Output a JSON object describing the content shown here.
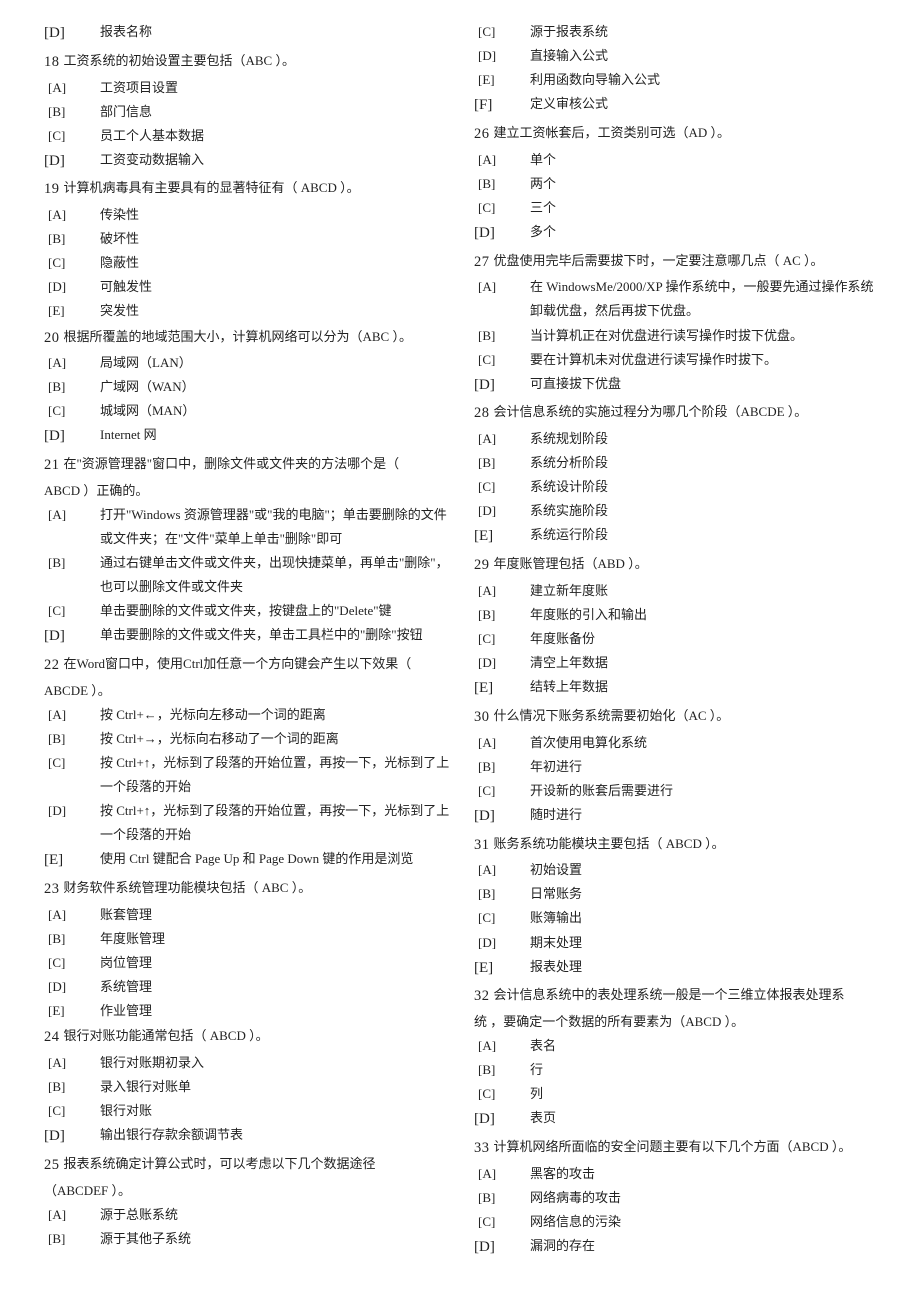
{
  "pre_option": {
    "letter": "[D]",
    "text": "报表名称",
    "big": true
  },
  "q18": {
    "num": "18",
    "text": "工资系统的初始设置主要包括（ABC  ）。",
    "opts": [
      {
        "l": "[A]",
        "t": "工资项目设置",
        "big": false
      },
      {
        "l": "[B]",
        "t": "部门信息",
        "big": false
      },
      {
        "l": "[C]",
        "t": "员工个人基本数据",
        "big": false
      },
      {
        "l": "[D]",
        "t": "工资变动数据输入",
        "big": true
      }
    ]
  },
  "q19": {
    "num": "19",
    "text": "计算机病毒具有主要具有的显著特征有（ ABCD ）。",
    "opts": [
      {
        "l": "[A]",
        "t": "传染性",
        "big": false
      },
      {
        "l": "[B]",
        "t": "破坏性",
        "big": false
      },
      {
        "l": "[C]",
        "t": "隐蔽性",
        "big": false
      },
      {
        "l": "[D]",
        "t": "可触发性",
        "big": false
      },
      {
        "l": "[E]",
        "t": "突发性",
        "big": false
      }
    ]
  },
  "q20": {
    "num": "20",
    "text": "根据所覆盖的地域范围大小，计算机网络可以分为（ABC  ）。",
    "opts": [
      {
        "l": "[A]",
        "t": "局域网（LAN）",
        "big": false
      },
      {
        "l": "[B]",
        "t": "广域网（WAN）",
        "big": false
      },
      {
        "l": "[C]",
        "t": "城域网（MAN）",
        "big": false
      },
      {
        "l": "[D]",
        "t": "Internet 网",
        "big": true
      }
    ]
  },
  "q21": {
    "num": "21",
    "line1": "在\"资源管理器\"窗口中，删除文件或文件夹的方法哪个是（",
    "line2": "ABCD ）正确的。",
    "opts": [
      {
        "l": "[A]",
        "t": "打开\"Windows 资源管理器\"或\"我的电脑\"；单击要删除的文件或文件夹；在\"文件\"菜单上单击\"删除\"即可",
        "big": false
      },
      {
        "l": "[B]",
        "t": "通过右键单击文件或文件夹，出现快捷菜单，再单击\"删除\"，也可以删除文件或文件夹",
        "big": false
      },
      {
        "l": "[C]",
        "t": "单击要删除的文件或文件夹，按键盘上的\"Delete\"键",
        "big": false
      },
      {
        "l": "[D]",
        "t": "单击要删除的文件或文件夹，单击工具栏中的\"删除\"按钮",
        "big": true
      }
    ]
  },
  "q22": {
    "num": "22",
    "line1": "在Word窗口中，使用Ctrl加任意一个方向键会产生以下效果（",
    "line2": "ABCDE ）。",
    "opts": [
      {
        "l": "[A]",
        "t": "按 Ctrl+←，光标向左移动一个词的距离",
        "big": false
      },
      {
        "l": "[B]",
        "t": "按 Ctrl+→，光标向右移动了一个词的距离",
        "big": false
      },
      {
        "l": "[C]",
        "t": "按 Ctrl+↑，光标到了段落的开始位置，再按一下，光标到了上一个段落的开始",
        "big": false
      },
      {
        "l": "[D]",
        "t": "按 Ctrl+↑，光标到了段落的开始位置，再按一下，光标到了上一个段落的开始",
        "big": false
      },
      {
        "l": "[E]",
        "t": "使用 Ctrl 键配合 Page Up 和 Page Down 键的作用是浏览",
        "big": true
      }
    ]
  },
  "q23": {
    "num": "23",
    "text": "财务软件系统管理功能模块包括（ ABC ）。",
    "opts": [
      {
        "l": "[A]",
        "t": "账套管理",
        "big": false
      },
      {
        "l": "[B]",
        "t": "年度账管理",
        "big": false
      },
      {
        "l": "[C]",
        "t": "岗位管理",
        "big": false
      },
      {
        "l": "[D]",
        "t": "系统管理",
        "big": false
      },
      {
        "l": "[E]",
        "t": "作业管理",
        "big": false
      }
    ]
  },
  "q24": {
    "num": "24",
    "text": " 银行对账功能通常包括（ ABCD ）。",
    "opts": [
      {
        "l": "[A]",
        "t": "银行对账期初录入",
        "big": false
      },
      {
        "l": "[B]",
        "t": "录入银行对账单",
        "big": false
      },
      {
        "l": "[C]",
        "t": "银行对账",
        "big": false
      },
      {
        "l": "[D]",
        "t": "输出银行存款余额调节表",
        "big": true
      }
    ]
  },
  "q25": {
    "num": "25",
    "line1": " 报表系统确定计算公式时，可以考虑以下几个数据途径",
    "line2": "（ABCDEF  ）。",
    "opts": [
      {
        "l": "[A]",
        "t": "源于总账系统",
        "big": false
      },
      {
        "l": "[B]",
        "t": "源于其他子系统",
        "big": false
      },
      {
        "l": "[C]",
        "t": "源于报表系统",
        "big": false
      },
      {
        "l": "[D]",
        "t": "直接输入公式",
        "big": false
      },
      {
        "l": "[E]",
        "t": "利用函数向导输入公式",
        "big": false
      },
      {
        "l": "[F]",
        "t": "定义审核公式",
        "big": true
      }
    ]
  },
  "q26": {
    "num": "26",
    "text": " 建立工资帐套后，工资类别可选（AD  ）。",
    "opts": [
      {
        "l": "[A]",
        "t": "单个",
        "big": false
      },
      {
        "l": "[B]",
        "t": "两个",
        "big": false
      },
      {
        "l": "[C]",
        "t": "三个",
        "big": false
      },
      {
        "l": "[D]",
        "t": "多个",
        "big": true
      }
    ]
  },
  "q27": {
    "num": "27",
    "text": " 优盘使用完毕后需要拔下时，一定要注意哪几点（ AC ）。",
    "opts": [
      {
        "l": "[A]",
        "t": "在 WindowsMe/2000/XP 操作系统中，一般要先通过操作系统卸载优盘，然后再拔下优盘。",
        "big": false
      },
      {
        "l": "[B]",
        "t": "当计算机正在对优盘进行读写操作时拔下优盘。",
        "big": false
      },
      {
        "l": "[C]",
        "t": "要在计算机未对优盘进行读写操作时拔下。",
        "big": false
      },
      {
        "l": "[D]",
        "t": "可直接拔下优盘",
        "big": true
      }
    ]
  },
  "q28": {
    "num": "28",
    "text": " 会计信息系统的实施过程分为哪几个阶段（ABCDE  ）。",
    "opts": [
      {
        "l": "[A]",
        "t": "系统规划阶段",
        "big": false
      },
      {
        "l": "[B]",
        "t": "系统分析阶段",
        "big": false
      },
      {
        "l": "[C]",
        "t": "系统设计阶段",
        "big": false
      },
      {
        "l": "[D]",
        "t": "系统实施阶段",
        "big": false
      },
      {
        "l": "[E]",
        "t": "系统运行阶段",
        "big": true
      }
    ]
  },
  "q29": {
    "num": "29",
    "text": " 年度账管理包括（ABD  ）。",
    "opts": [
      {
        "l": "[A]",
        "t": "建立新年度账",
        "big": false
      },
      {
        "l": "[B]",
        "t": "年度账的引入和输出",
        "big": false
      },
      {
        "l": "[C]",
        "t": "年度账备份",
        "big": false
      },
      {
        "l": "[D]",
        "t": "清空上年数据",
        "big": false
      },
      {
        "l": "[E]",
        "t": "结转上年数据",
        "big": true
      }
    ]
  },
  "q30": {
    "num": "30",
    "text": " 什么情况下账务系统需要初始化（AC  ）。",
    "opts": [
      {
        "l": "[A]",
        "t": "首次使用电算化系统",
        "big": false
      },
      {
        "l": "[B]",
        "t": "年初进行",
        "big": false
      },
      {
        "l": "[C]",
        "t": "开设新的账套后需要进行",
        "big": false
      },
      {
        "l": "[D]",
        "t": "随时进行",
        "big": true
      }
    ]
  },
  "q31": {
    "num": "31",
    "text": " 账务系统功能模块主要包括（ ABCD ）。",
    "opts": [
      {
        "l": "[A]",
        "t": "初始设置",
        "big": false
      },
      {
        "l": "[B]",
        "t": "日常账务",
        "big": false
      },
      {
        "l": "[C]",
        "t": "账簿输出",
        "big": false
      },
      {
        "l": "[D]",
        "t": "期末处理",
        "big": false
      },
      {
        "l": "[E]",
        "t": "报表处理",
        "big": true
      }
    ]
  },
  "q32": {
    "num": "32",
    "line1": " 会计信息系统中的表处理系统一般是一个三维立体报表处理系",
    "line2": "统 ，要确定一个数据的所有要素为（ABCD  ）。",
    "opts": [
      {
        "l": "[A]",
        "t": "表名",
        "big": false
      },
      {
        "l": "[B]",
        "t": "行",
        "big": false
      },
      {
        "l": "[C]",
        "t": "列",
        "big": false
      },
      {
        "l": "[D]",
        "t": "表页",
        "big": true
      }
    ]
  },
  "q33": {
    "num": "33",
    "text": "计算机网络所面临的安全问题主要有以下几个方面（ABCD  ）。",
    "opts": [
      {
        "l": "[A]",
        "t": "黑客的攻击",
        "big": false
      },
      {
        "l": "[B]",
        "t": "网络病毒的攻击",
        "big": false
      },
      {
        "l": "[C]",
        "t": "网络信息的污染",
        "big": false
      },
      {
        "l": "[D]",
        "t": "漏洞的存在",
        "big": true
      }
    ]
  }
}
